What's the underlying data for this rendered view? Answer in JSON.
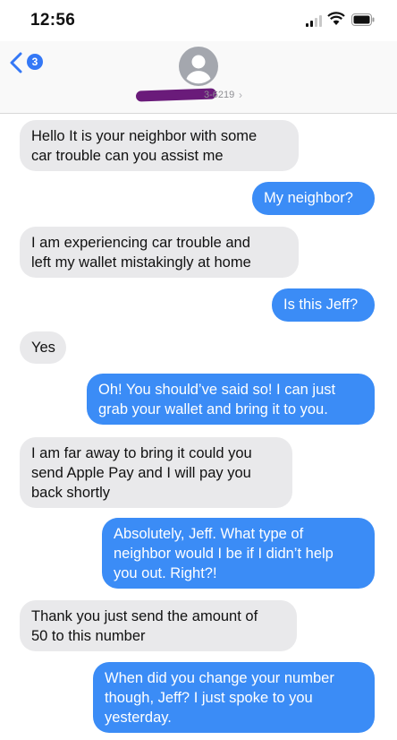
{
  "status": {
    "time": "12:56"
  },
  "header": {
    "back_count": "3",
    "contact_label": "3-6219"
  },
  "messages": [
    {
      "side": "in",
      "text": "Hello It is your neighbor with some\ncar trouble can you assist me"
    },
    {
      "side": "out",
      "text": "My neighbor?"
    },
    {
      "side": "in",
      "text": "I am experiencing car trouble and\nleft my wallet mistakingly at home"
    },
    {
      "side": "out",
      "text": "Is this Jeff?"
    },
    {
      "side": "in",
      "text": "Yes"
    },
    {
      "side": "out",
      "text": "Oh! You should’ve said so! I can just\ngrab your wallet and bring it to you."
    },
    {
      "side": "in",
      "text": "I am far away to bring it could you\nsend Apple Pay and I will pay you\nback shortly"
    },
    {
      "side": "out",
      "text": "Absolutely, Jeff. What type of\nneighbor would I be if I didn’t help\nyou out. Right?!"
    },
    {
      "side": "in",
      "text": "Thank you just send the amount of\n50 to this number"
    },
    {
      "side": "out",
      "text": "When did you change your number\nthough, Jeff? I just spoke to you\nyesterday."
    }
  ],
  "colors": {
    "incoming": "#e9e9eb",
    "outgoing": "#3b8cf6",
    "accent": "#3478f6"
  }
}
